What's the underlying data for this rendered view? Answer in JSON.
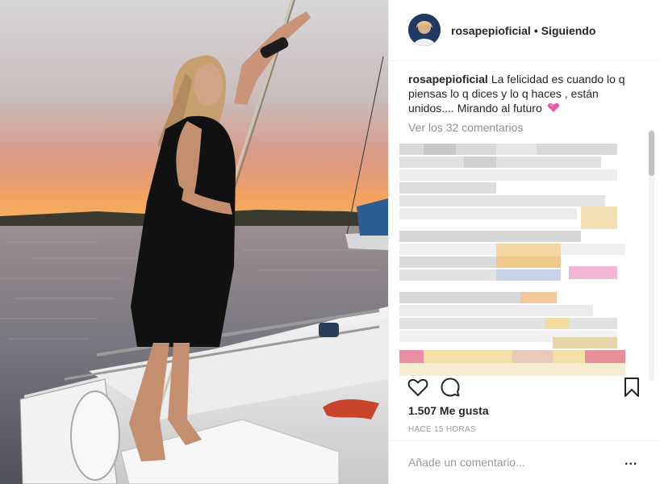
{
  "post": {
    "photo_icon": "sunset-sailboat-photo",
    "username": "rosapepioficial",
    "separator": "•",
    "follow_status": "Siguiendo",
    "caption_user": "rosapepioficial",
    "caption_text": "La felicidad es cuando lo q piensas lo q dices y lo q haces , están unidos.... Mirando al futuro",
    "caption_emoji": "heart-emoji",
    "view_comments": "Ver los 32 comentarios",
    "likes": "1.507 Me gusta",
    "timestamp": "HACE 15 HORAS",
    "comment_placeholder": "Añade un comentario...",
    "more_label": "..."
  },
  "icons": {
    "like": "heart-icon",
    "comment": "comment-icon",
    "save": "bookmark-icon",
    "more": "more-options-icon"
  },
  "colors": {
    "text": "#262626",
    "muted": "#8e8e8e",
    "border": "#efefef",
    "emoji_pink": "#e75aa8"
  }
}
